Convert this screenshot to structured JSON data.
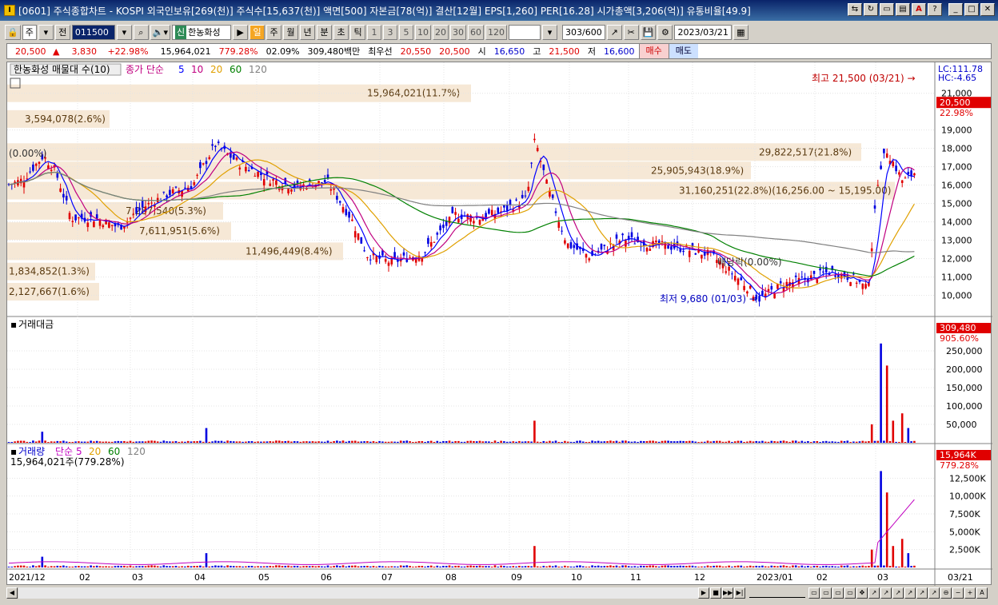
{
  "titlebar": {
    "icon_label": "I",
    "text": "[0601] 주식종합차트 - KOSPI 외국인보유[269(천)] 주식수[15,637(천)] 액면[500] 자본금[78(억)] 결산[12월] EPS[1,260] PER[16.28] 시가총액[3,206(억)] 유통비율[49.9]"
  },
  "toolbar": {
    "type_select": "주",
    "prev_label": "전",
    "code": "011500",
    "stock_badge": "신",
    "stock_name": "한농화성",
    "periods": [
      "일",
      "주",
      "월",
      "년",
      "분",
      "초",
      "틱"
    ],
    "selected_period": "일",
    "numbers": [
      "1",
      "3",
      "5",
      "10",
      "20",
      "30",
      "60",
      "120"
    ],
    "count": "303",
    "count_total": "/600",
    "date": "2023/03/21"
  },
  "info": {
    "price": "20,500",
    "change": "3,830",
    "change_pct": "+22.98%",
    "volume": "15,964,021",
    "volume_ratio": "779.28%",
    "turnover": "02.09%",
    "amount": "309,480백만",
    "best_label": "최우선",
    "ask": "20,550",
    "bid": "20,500",
    "open_label": "시",
    "open": "16,650",
    "high_label": "고",
    "high": "21,500",
    "low_label": "저",
    "low": "16,600",
    "buy_label": "매수",
    "sell_label": "매도"
  },
  "price_panel": {
    "title": "한농화성 매물대 수(10)",
    "ma_label": "종가 단순",
    "ma_periods": [
      "5",
      "10",
      "20",
      "60",
      "120"
    ],
    "ma_colors": [
      "#0000ff",
      "#c00080",
      "#e0a000",
      "#008000",
      "#808080"
    ],
    "lc": "LC:111.78",
    "hc": "HC:-4.65",
    "current_price": "20,500",
    "current_pct": "22.98%",
    "high_note": "최고 21,500 (03/21) →",
    "low_note": "최저 9,680 (01/03) →",
    "ex_dividend": "배당락(0.00%)",
    "left_pct": "(0.00%)",
    "volume_profile": [
      "15,964,021(11.7%)",
      "3,594,078(2.6%)",
      "29,822,517(21.8%)",
      "25,905,943(18.9%)",
      "31,160,251(22.8%)(16,256.00 ~ 15,195.00)",
      "7,287,540(5.3%)",
      "7,611,951(5.6%)",
      "11,496,449(8.4%)",
      "1,834,852(1.3%)",
      "2,127,667(1.6%)"
    ],
    "y_ticks": [
      "21,000",
      "19,000",
      "18,000",
      "17,000",
      "16,000",
      "15,000",
      "14,000",
      "13,000",
      "12,000",
      "11,000",
      "10,000"
    ]
  },
  "amount_panel": {
    "title": "거래대금",
    "current": "309,480",
    "pct": "905.60%",
    "y_ticks": [
      "250,000",
      "200,000",
      "150,000",
      "100,000",
      "50,000"
    ]
  },
  "volume_panel": {
    "title": "거래량",
    "ma_label": "단순",
    "ma_periods": [
      "5",
      "20",
      "60",
      "120"
    ],
    "ma_colors": [
      "#c000c0",
      "#e0a000",
      "#008000",
      "#808080"
    ],
    "subtitle": "15,964,021주(779.28%)",
    "current": "15,964K",
    "pct": "779.28%",
    "y_ticks": [
      "12,500K",
      "10,000K",
      "7,500K",
      "5,000K",
      "2,500K"
    ]
  },
  "x_axis": {
    "labels": [
      "2021/12",
      "02",
      "03",
      "04",
      "05",
      "06",
      "07",
      "08",
      "09",
      "10",
      "11",
      "12",
      "2023/01",
      "02",
      "03"
    ],
    "end_label": "03/21"
  },
  "chart_data": {
    "type": "candlestick",
    "x_range": [
      "2021/12",
      "2023/03/21"
    ],
    "price_range": [
      9680,
      21500
    ],
    "last_close": 20500,
    "high": {
      "value": 21500,
      "date": "03/21"
    },
    "low": {
      "value": 9680,
      "date": "01/03"
    },
    "volume_profile_levels": [
      {
        "volume": 15964021,
        "pct": 11.7
      },
      {
        "volume": 3594078,
        "pct": 2.6
      },
      {
        "volume": 29822517,
        "pct": 21.8
      },
      {
        "volume": 25905943,
        "pct": 18.9
      },
      {
        "volume": 31160251,
        "pct": 22.8
      },
      {
        "volume": 7287540,
        "pct": 5.3
      },
      {
        "volume": 7611951,
        "pct": 5.6
      },
      {
        "volume": 11496449,
        "pct": 8.4
      },
      {
        "volume": 1834852,
        "pct": 1.3
      },
      {
        "volume": 2127667,
        "pct": 1.6
      }
    ],
    "amount_last": 309480,
    "volume_last_k": 15964
  }
}
